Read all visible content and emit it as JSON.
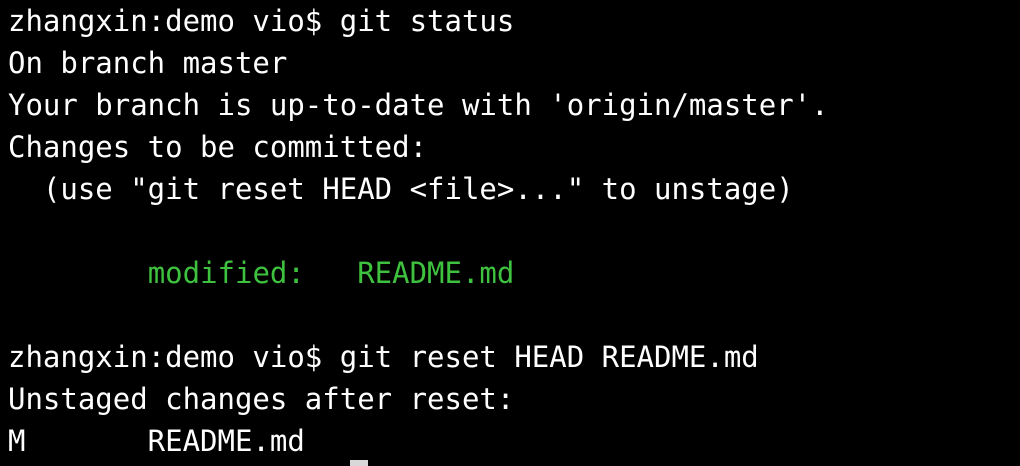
{
  "terminal": {
    "lines": [
      {
        "segments": [
          "zhangxin:demo vio$ git status"
        ]
      },
      {
        "segments": [
          "On branch master"
        ]
      },
      {
        "segments": [
          "Your branch is up-to-date with 'origin/master'."
        ]
      },
      {
        "segments": [
          "Changes to be committed:"
        ]
      },
      {
        "segments": [
          "  (use \"git reset HEAD <file>...\" to unstage)"
        ]
      },
      {
        "segments": [
          ""
        ]
      },
      {
        "segments": [
          "        ",
          "modified:   README.md"
        ]
      },
      {
        "segments": [
          ""
        ]
      },
      {
        "segments": [
          "zhangxin:demo vio$ git reset HEAD README.md"
        ]
      },
      {
        "segments": [
          "Unstaged changes after reset:"
        ]
      },
      {
        "segments": [
          "M       README.md"
        ]
      }
    ],
    "colors": {
      "background": "#000000",
      "text": "#ffffff",
      "staged_green": "#3ec13e",
      "cursor": "#d8d8d8"
    }
  }
}
